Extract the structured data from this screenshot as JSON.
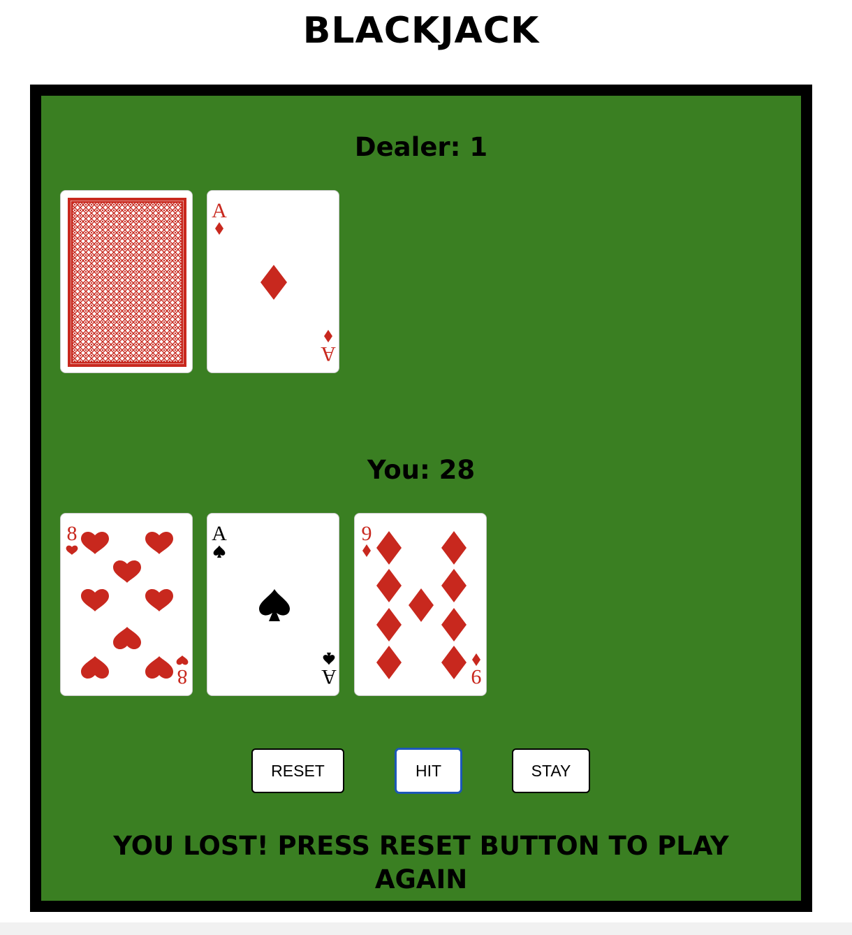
{
  "title": "BLACKJACK",
  "dealer": {
    "label": "Dealer: 1",
    "cards": [
      {
        "face_down": true
      },
      {
        "rank": "A",
        "suit": "diamonds"
      }
    ]
  },
  "player": {
    "label": "You: 28",
    "cards": [
      {
        "rank": "8",
        "suit": "hearts"
      },
      {
        "rank": "A",
        "suit": "spades"
      },
      {
        "rank": "9",
        "suit": "diamonds"
      }
    ]
  },
  "buttons": {
    "reset": "RESET",
    "hit": "HIT",
    "stay": "STAY"
  },
  "status_message": "YOU LOST! PRESS RESET BUTTON TO PLAY AGAIN",
  "colors": {
    "felt": "#3a7f22",
    "border": "#000000",
    "red_suit": "#c8281e",
    "black_suit": "#000000",
    "card_back": "#c8281e"
  }
}
